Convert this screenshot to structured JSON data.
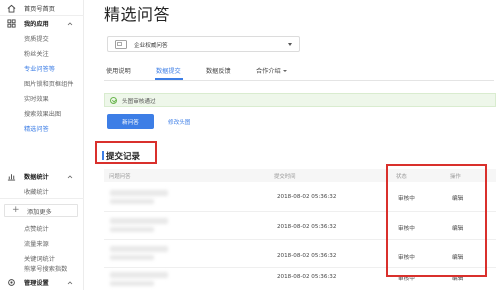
{
  "sidebar": {
    "home": {
      "label": "首页号首页",
      "icon": "home-icon"
    },
    "my_apps": {
      "label": "我的应用",
      "icon": "apps-grid-icon"
    },
    "my_apps_items": [
      {
        "label": "资质提交"
      },
      {
        "label": "粉丝关注"
      },
      {
        "label": "专业问答等",
        "active": false
      },
      {
        "label": "图片锁和页框组件"
      },
      {
        "label": "实时效果"
      },
      {
        "label": "搜索效果出图"
      },
      {
        "label": "精选问答",
        "active": true
      }
    ],
    "add_more": "添加更多",
    "data_stats": {
      "label": "数据统计",
      "icon": "chart-icon"
    },
    "data_stats_items": [
      {
        "label": "收藏统计"
      },
      {
        "label": "点赞统计"
      },
      {
        "label": "流量来源"
      },
      {
        "label": "关键词统计"
      },
      {
        "label": "熊掌号搜索指数"
      }
    ],
    "admin": {
      "label": "管理设置",
      "icon": "gear-icon"
    }
  },
  "main": {
    "title": "精选问答",
    "account_selector": {
      "value": "企业权威问答",
      "icon": "account-icon"
    },
    "tabs": [
      {
        "label": "使用说明",
        "active": false
      },
      {
        "label": "数据提交",
        "active": true
      },
      {
        "label": "数据反馈",
        "active": false
      },
      {
        "label": "合作介绍",
        "active": false,
        "has_dropdown": true
      }
    ],
    "notice": "头图审核通过",
    "primary_button": "新问答",
    "link_button": "修改头图",
    "section_title": "提交记录",
    "table": {
      "headers": [
        "问题问答",
        "提交时间",
        "状态",
        "操作"
      ],
      "rows": [
        {
          "time": "2018-08-02 05:36:32",
          "status": "审核中",
          "action": "编辑"
        },
        {
          "time": "2018-08-02 05:36:32",
          "status": "审核中",
          "action": "编辑"
        },
        {
          "time": "2018-08-02 05:36:32",
          "status": "审核中",
          "action": "编辑"
        },
        {
          "time": "2018-08-02 05:36:32",
          "status": "审核中",
          "action": "编辑"
        }
      ]
    }
  },
  "colors": {
    "accent": "#3d7ee6",
    "highlight": "#d9302c",
    "success": "#6bb64f"
  }
}
